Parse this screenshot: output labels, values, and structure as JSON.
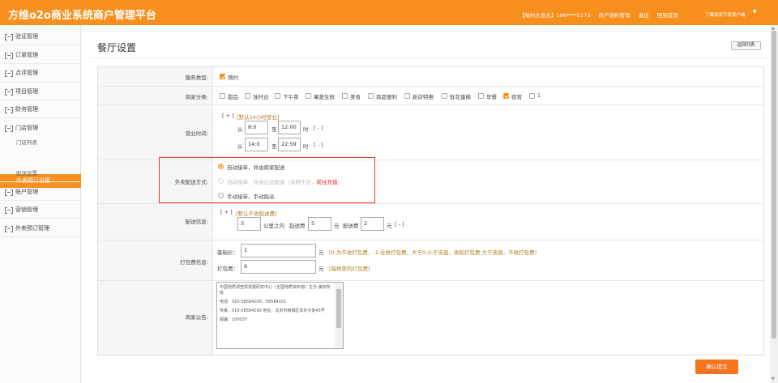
{
  "header": {
    "title": "方维o2o商业系统商户管理平台",
    "user": "【福州大鱼丸】186****5173",
    "nav": [
      "商户资料管理",
      "退出",
      "回到首页"
    ],
    "mobile_link": "下载商家手机客户端",
    "caret": "▼"
  },
  "sidebar": {
    "items": [
      "验证管理",
      "订单管理",
      "点评管理",
      "项目管理",
      "财务管理",
      "门店管理"
    ],
    "sub_items": [
      "门店列表",
      "外卖预订设置",
      "配送设置"
    ],
    "items_after": [
      "账户管理",
      "营销管理",
      "外卖预订管理"
    ]
  },
  "page": {
    "title": "餐厅设置",
    "back_button": "返回列表",
    "submit_button": "确认提交"
  },
  "form": {
    "service_type": {
      "label": "服务类型:",
      "option": "预约",
      "checked": true
    },
    "shop_category": {
      "label": "商家分类:",
      "options": [
        {
          "text": "甜品",
          "checked": false
        },
        {
          "text": "准时达",
          "checked": false
        },
        {
          "text": "下午茶",
          "checked": false
        },
        {
          "text": "果蔬生鲜",
          "checked": false
        },
        {
          "text": "美食",
          "checked": false
        },
        {
          "text": "商超便利",
          "checked": false
        },
        {
          "text": "新店特惠",
          "checked": false
        },
        {
          "text": "鲜花蛋糕",
          "checked": false
        },
        {
          "text": "早餐",
          "checked": false
        },
        {
          "text": "夜宵",
          "checked": true
        },
        {
          "text": "1",
          "checked": false
        }
      ]
    },
    "business_hours": {
      "label": "营业时间:",
      "add": "[ + ]",
      "default_note": "[默认24小时营业]",
      "slots": [
        {
          "from_label": "从",
          "from": "8:0",
          "to_label": "至",
          "to": "12:00",
          "unit": "时",
          "remove": "[ - ]"
        },
        {
          "from_label": "从",
          "from": "14:0",
          "to_label": "至",
          "to": "22:59",
          "unit": "时",
          "remove": "[ - ]"
        }
      ]
    },
    "delivery_mode": {
      "label": "外卖配送方式:",
      "options": [
        {
          "text": "自动接单，并由商家配送",
          "selected": true,
          "disabled": false
        },
        {
          "text": "自动接单，并由达达配送（余额不足，",
          "link": "前往充值",
          "tail": "）",
          "selected": false,
          "disabled": true
        },
        {
          "text": "手动接单，手动指派",
          "selected": false,
          "disabled": false
        }
      ]
    },
    "delivery_fee": {
      "label": "配送信息:",
      "add": "[ + ]",
      "default_note": "[默认不收配送费]",
      "distance": "3",
      "distance_unit": "公里之内",
      "start_label": "起送费",
      "start": "5",
      "start_unit": "元",
      "fee_label": "配送费",
      "fee": "2",
      "fee_unit": "元",
      "remove": "[ - ]"
    },
    "packing_fee": {
      "label": "打包费信息:",
      "base_label": "基础价：",
      "base": "1",
      "base_unit": "元",
      "base_note": "[0:为不收打包费，-1:全收打包费，大于0:小于该值，收取打包费;大于该值，不收打包费]",
      "fee_label": "打包费：",
      "fee": "6",
      "fee_unit": "元",
      "fee_note": "[每样菜的打包费]"
    },
    "announcement": {
      "label": "商家公告:",
      "lines": [
        "中国地质调查局发展研究中心（全国地质资料馆）主办 版权所有",
        "电话：010-58584100，58584101",
        "传真：010-58584290 地址：北京市西城区阜外大街45号",
        "邮编：100037"
      ]
    }
  }
}
